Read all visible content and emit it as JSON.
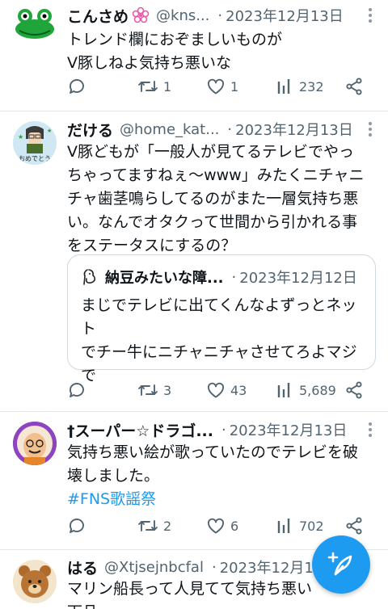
{
  "tweets": [
    {
      "name": "こんさめ",
      "handle": "@kns...",
      "date": "2023年12月13日",
      "lines": [
        "トレンド欄におぞましいものが",
        "V豚しねよ気持ち悪いな"
      ],
      "replies": "",
      "retweets": "1",
      "likes": "1",
      "views": "232"
    },
    {
      "name": "だける",
      "handle": "@home_kat...",
      "date": "2023年12月13日",
      "lines": [
        "V豚どもが「一般人が見てるテレビでやっ",
        "ちゃってますねぇ〜www」みたくニチャニ",
        "チャ歯茎鳴らしてるのがまた一層気持ち悪",
        "い。なんでオタクって世間から引かれる事",
        "をステータスにするの？"
      ],
      "quote": {
        "name": "納豆みたいな障...",
        "date": "2023年12月12日",
        "lines": [
          "まじでテレビに出てくんなよずっとネット",
          "でチー牛にニチャニチャさせてろよマジ",
          "で"
        ]
      },
      "replies": "",
      "retweets": "3",
      "likes": "43",
      "views": "5,689"
    },
    {
      "name": "†スーパー☆ドラゴ...",
      "handle": "",
      "date": "2023年12月13日",
      "lines": [
        "気持ち悪い絵が歌っていたのでテレビを破",
        "壊しました。"
      ],
      "hashtag": "#FNS歌謡祭",
      "replies": "",
      "retweets": "2",
      "likes": "6",
      "views": "702"
    },
    {
      "name": "はる",
      "handle": "@Xtjsejnbcfal",
      "date": "2023年12月1",
      "lines": [
        "マリン船長って人見てて気持ち悪い",
        "下品"
      ]
    }
  ],
  "avatar_labels": {
    "daker": "おめでとう"
  },
  "colors": {
    "accent": "#1d9bf0",
    "muted": "#536471",
    "border": "#cfd9de"
  },
  "icons": [
    "reply-icon",
    "retweet-icon",
    "like-icon",
    "views-icon",
    "share-icon",
    "more-icon",
    "compose-icon",
    "pink-flower-icon"
  ]
}
